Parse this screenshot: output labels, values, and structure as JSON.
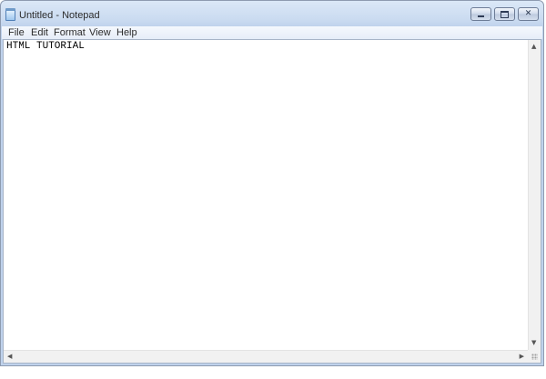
{
  "window": {
    "title": "Untitled - Notepad"
  },
  "icons": {
    "app": "notepad-icon",
    "minimize": "minimize-icon",
    "maximize": "maximize-icon",
    "close": "close-icon"
  },
  "menu": {
    "items": [
      {
        "label": "File"
      },
      {
        "label": "Edit"
      },
      {
        "label": "Format"
      },
      {
        "label": "View"
      },
      {
        "label": "Help"
      }
    ]
  },
  "document": {
    "text": "HTML TUTORIAL"
  },
  "controls": {
    "close_glyph": "✕"
  }
}
